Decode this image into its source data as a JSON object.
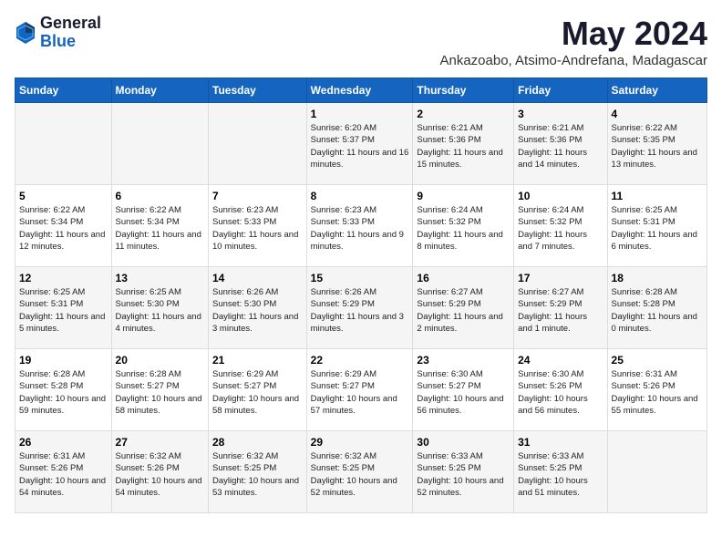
{
  "logo": {
    "general": "General",
    "blue": "Blue"
  },
  "title": "May 2024",
  "subtitle": "Ankazoabo, Atsimo-Andrefana, Madagascar",
  "days_of_week": [
    "Sunday",
    "Monday",
    "Tuesday",
    "Wednesday",
    "Thursday",
    "Friday",
    "Saturday"
  ],
  "weeks": [
    [
      {
        "day": "",
        "info": ""
      },
      {
        "day": "",
        "info": ""
      },
      {
        "day": "",
        "info": ""
      },
      {
        "day": "1",
        "info": "Sunrise: 6:20 AM\nSunset: 5:37 PM\nDaylight: 11 hours and 16 minutes."
      },
      {
        "day": "2",
        "info": "Sunrise: 6:21 AM\nSunset: 5:36 PM\nDaylight: 11 hours and 15 minutes."
      },
      {
        "day": "3",
        "info": "Sunrise: 6:21 AM\nSunset: 5:36 PM\nDaylight: 11 hours and 14 minutes."
      },
      {
        "day": "4",
        "info": "Sunrise: 6:22 AM\nSunset: 5:35 PM\nDaylight: 11 hours and 13 minutes."
      }
    ],
    [
      {
        "day": "5",
        "info": "Sunrise: 6:22 AM\nSunset: 5:34 PM\nDaylight: 11 hours and 12 minutes."
      },
      {
        "day": "6",
        "info": "Sunrise: 6:22 AM\nSunset: 5:34 PM\nDaylight: 11 hours and 11 minutes."
      },
      {
        "day": "7",
        "info": "Sunrise: 6:23 AM\nSunset: 5:33 PM\nDaylight: 11 hours and 10 minutes."
      },
      {
        "day": "8",
        "info": "Sunrise: 6:23 AM\nSunset: 5:33 PM\nDaylight: 11 hours and 9 minutes."
      },
      {
        "day": "9",
        "info": "Sunrise: 6:24 AM\nSunset: 5:32 PM\nDaylight: 11 hours and 8 minutes."
      },
      {
        "day": "10",
        "info": "Sunrise: 6:24 AM\nSunset: 5:32 PM\nDaylight: 11 hours and 7 minutes."
      },
      {
        "day": "11",
        "info": "Sunrise: 6:25 AM\nSunset: 5:31 PM\nDaylight: 11 hours and 6 minutes."
      }
    ],
    [
      {
        "day": "12",
        "info": "Sunrise: 6:25 AM\nSunset: 5:31 PM\nDaylight: 11 hours and 5 minutes."
      },
      {
        "day": "13",
        "info": "Sunrise: 6:25 AM\nSunset: 5:30 PM\nDaylight: 11 hours and 4 minutes."
      },
      {
        "day": "14",
        "info": "Sunrise: 6:26 AM\nSunset: 5:30 PM\nDaylight: 11 hours and 3 minutes."
      },
      {
        "day": "15",
        "info": "Sunrise: 6:26 AM\nSunset: 5:29 PM\nDaylight: 11 hours and 3 minutes."
      },
      {
        "day": "16",
        "info": "Sunrise: 6:27 AM\nSunset: 5:29 PM\nDaylight: 11 hours and 2 minutes."
      },
      {
        "day": "17",
        "info": "Sunrise: 6:27 AM\nSunset: 5:29 PM\nDaylight: 11 hours and 1 minute."
      },
      {
        "day": "18",
        "info": "Sunrise: 6:28 AM\nSunset: 5:28 PM\nDaylight: 11 hours and 0 minutes."
      }
    ],
    [
      {
        "day": "19",
        "info": "Sunrise: 6:28 AM\nSunset: 5:28 PM\nDaylight: 10 hours and 59 minutes."
      },
      {
        "day": "20",
        "info": "Sunrise: 6:28 AM\nSunset: 5:27 PM\nDaylight: 10 hours and 58 minutes."
      },
      {
        "day": "21",
        "info": "Sunrise: 6:29 AM\nSunset: 5:27 PM\nDaylight: 10 hours and 58 minutes."
      },
      {
        "day": "22",
        "info": "Sunrise: 6:29 AM\nSunset: 5:27 PM\nDaylight: 10 hours and 57 minutes."
      },
      {
        "day": "23",
        "info": "Sunrise: 6:30 AM\nSunset: 5:27 PM\nDaylight: 10 hours and 56 minutes."
      },
      {
        "day": "24",
        "info": "Sunrise: 6:30 AM\nSunset: 5:26 PM\nDaylight: 10 hours and 56 minutes."
      },
      {
        "day": "25",
        "info": "Sunrise: 6:31 AM\nSunset: 5:26 PM\nDaylight: 10 hours and 55 minutes."
      }
    ],
    [
      {
        "day": "26",
        "info": "Sunrise: 6:31 AM\nSunset: 5:26 PM\nDaylight: 10 hours and 54 minutes."
      },
      {
        "day": "27",
        "info": "Sunrise: 6:32 AM\nSunset: 5:26 PM\nDaylight: 10 hours and 54 minutes."
      },
      {
        "day": "28",
        "info": "Sunrise: 6:32 AM\nSunset: 5:25 PM\nDaylight: 10 hours and 53 minutes."
      },
      {
        "day": "29",
        "info": "Sunrise: 6:32 AM\nSunset: 5:25 PM\nDaylight: 10 hours and 52 minutes."
      },
      {
        "day": "30",
        "info": "Sunrise: 6:33 AM\nSunset: 5:25 PM\nDaylight: 10 hours and 52 minutes."
      },
      {
        "day": "31",
        "info": "Sunrise: 6:33 AM\nSunset: 5:25 PM\nDaylight: 10 hours and 51 minutes."
      },
      {
        "day": "",
        "info": ""
      }
    ]
  ]
}
